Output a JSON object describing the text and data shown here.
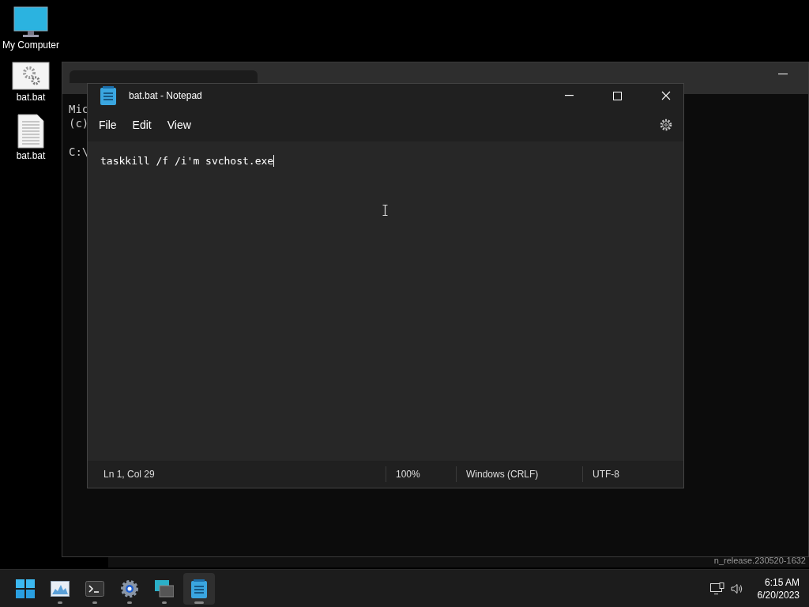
{
  "desktop_icons": [
    {
      "kind": "computer",
      "label": "My Computer"
    },
    {
      "kind": "settings-file",
      "label": "bat.bat"
    },
    {
      "kind": "text-file",
      "label": "bat.bat"
    }
  ],
  "terminal": {
    "lines": [
      "Mic",
      "(c)",
      "C:\\"
    ],
    "background_text": "n_release.230520-1632"
  },
  "notepad": {
    "title": "bat.bat - Notepad",
    "menu": [
      "File",
      "Edit",
      "View"
    ],
    "content": "taskkill /f /i'm svchost.exe",
    "status_bar": [
      "Ln 1, Col 29",
      "100%",
      "Windows (CRLF)",
      "UTF-8"
    ]
  },
  "taskbar": {
    "apps": [
      {
        "kind": "start",
        "selected": false
      },
      {
        "kind": "monitor",
        "selected": false
      },
      {
        "kind": "terminal",
        "selected": false
      },
      {
        "kind": "settings",
        "selected": false
      },
      {
        "kind": "window",
        "selected": false
      },
      {
        "kind": "notepad",
        "selected": true
      }
    ],
    "time": "6:15 AM",
    "date": "6/20/2023"
  }
}
